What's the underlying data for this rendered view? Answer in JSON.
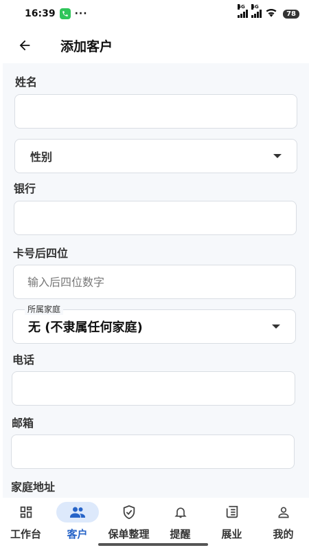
{
  "status_bar": {
    "time": "16:39",
    "dots": "···",
    "network_1": "5G",
    "network_2": "5G",
    "battery": "78",
    "icons": [
      "phone-icon",
      "signal-icon",
      "signal-icon",
      "wifi-icon",
      "battery-icon"
    ]
  },
  "header": {
    "back_icon": "arrow-left-icon",
    "title": "添加客户"
  },
  "form": {
    "name_label": "姓名",
    "name_value": "",
    "gender_placeholder": "性别",
    "bank_label": "银行",
    "bank_value": "",
    "card_label": "卡号后四位",
    "card_placeholder": "输入后四位数字",
    "family_label": "所属家庭",
    "family_value": "无 (不隶属任何家庭)",
    "phone_label": "电话",
    "phone_value": "",
    "email_label": "邮箱",
    "email_value": "",
    "address_label": "家庭地址"
  },
  "bottom_nav": {
    "active_color": "#2764c8",
    "active_bg": "#dde9fb",
    "items": [
      {
        "label": "工作台",
        "icon": "dashboard-grid-icon",
        "active": false
      },
      {
        "label": "客户",
        "icon": "people-icon",
        "active": true
      },
      {
        "label": "保单整理",
        "icon": "shield-check-icon",
        "active": false
      },
      {
        "label": "提醒",
        "icon": "bell-icon",
        "active": false
      },
      {
        "label": "展业",
        "icon": "newspaper-icon",
        "active": false
      },
      {
        "label": "我的",
        "icon": "person-icon",
        "active": false
      }
    ]
  }
}
